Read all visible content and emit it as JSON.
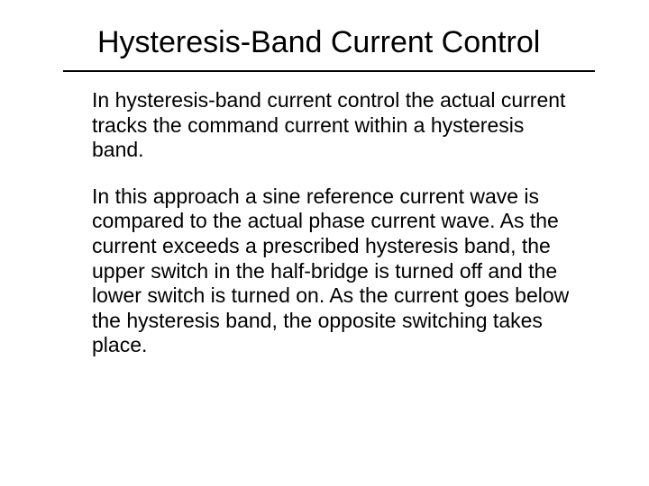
{
  "slide": {
    "title": "Hysteresis-Band Current Control",
    "paragraphs": [
      "In hysteresis-band current control the actual current tracks the command current within a hysteresis band.",
      "In this approach a sine reference current wave is compared to the actual phase current wave. As the current exceeds a prescribed hysteresis band, the upper switch in the half-bridge is turned off and the lower switch is turned on. As the current goes below the hysteresis band, the opposite switching takes place."
    ]
  }
}
